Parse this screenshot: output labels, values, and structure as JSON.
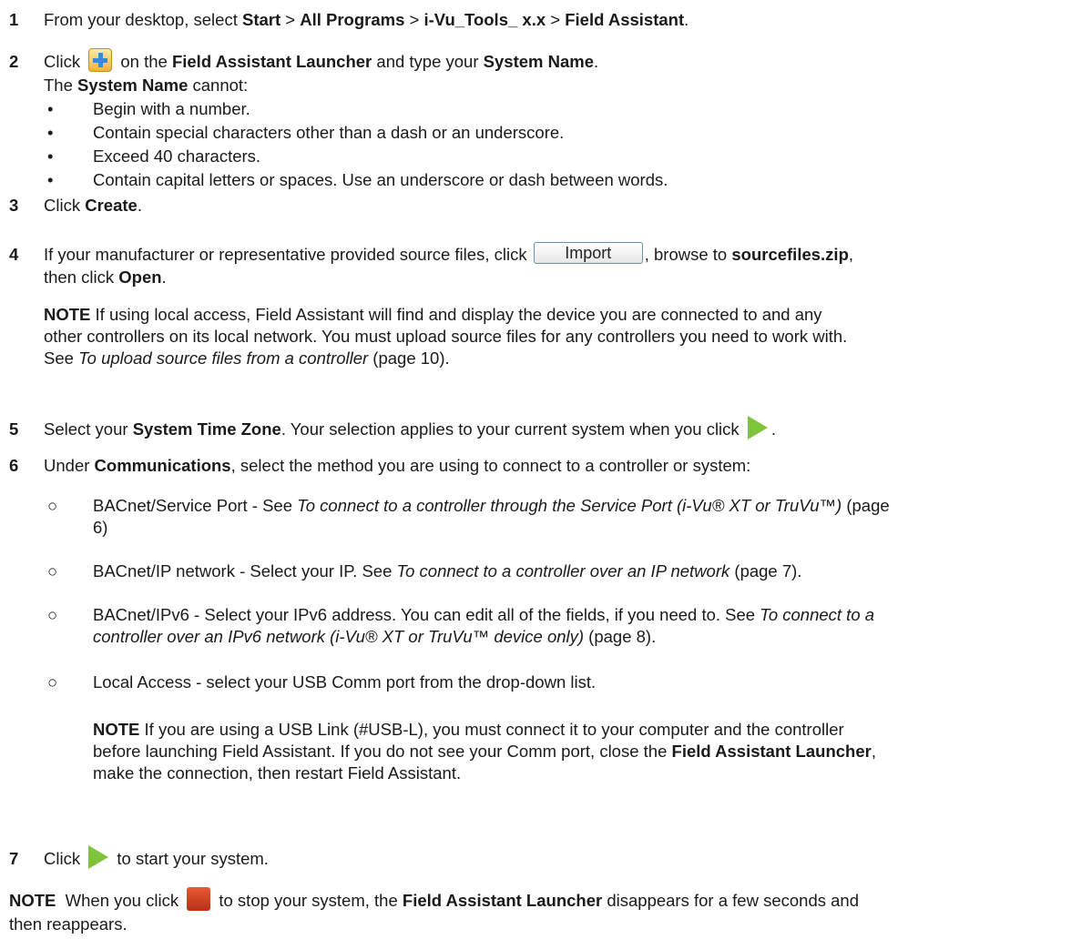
{
  "s1": {
    "num": "1",
    "a": "From your desktop, select ",
    "b1": "Start",
    "sep1": " > ",
    "b2": "All Programs",
    "sep2": " > ",
    "b3": "i-Vu_Tools_ x.x",
    "sep3": " > ",
    "b4": "Field Assistant",
    "end": "."
  },
  "s2": {
    "num": "2",
    "a": "Click ",
    "b": " on the ",
    "b1": "Field Assistant Launcher",
    "c": " and type your ",
    "b2": "System Name",
    "end": ".",
    "l2a": "The ",
    "l2b": "System Name",
    "l2c": " cannot:",
    "bullets": [
      "Begin with a number.",
      "Contain special characters other than a dash or an underscore.",
      "Exceed 40 characters.",
      "Contain capital letters or spaces. Use an underscore or dash between words."
    ]
  },
  "s3": {
    "num": "3",
    "a": "Click ",
    "b": "Create",
    "end": "."
  },
  "s4": {
    "num": "4",
    "a": "If your manufacturer or representative provided source files, click ",
    "btn": "Import",
    "c": ", browse to ",
    "b1": "sourcefiles.zip",
    "d": ",",
    "l2a": "then click ",
    "l2b": "Open",
    "l2c": ".",
    "note_label": "NOTE",
    "note_l1": " If using local access, Field Assistant will find and display the device you are connected to and any",
    "note_l2": "other controllers on its local network. You must upload source files for any controllers you need to work with.",
    "note_l3a": "See ",
    "note_l3i": "To upload source files from a controller",
    "note_l3b": " (page 10)."
  },
  "s5": {
    "num": "5",
    "a": "Select your ",
    "b": "System Time Zone",
    "c": ". Your selection applies to your current system when you click ",
    "end": "."
  },
  "s6": {
    "num": "6",
    "a": "Under ",
    "b": "Communications",
    "c": ", select the method you are using to connect to a controller or system:",
    "o1a": "BACnet/Service Port - See ",
    "o1i": "To connect to a controller through the Service Port (i-Vu® XT or TruVu™)",
    "o1b": " (page",
    "o1c": "6)",
    "o2a": "BACnet/IP network - Select your IP. See ",
    "o2i": "To connect to a controller over an IP network",
    "o2b": " (page 7).",
    "o3a": "BACnet/IPv6 - Select your IPv6 address. You can edit all of the fields, if you need to. See ",
    "o3i": "To connect to a",
    "o3i2": "controller over an IPv6 network (i-Vu® XT or TruVu™ device only)",
    "o3b": " (page 8).",
    "o4": "Local Access - select your USB Comm port from the drop-down list.",
    "note_label": "NOTE",
    "note_l1": " If you are using a USB Link (#USB-L), you must connect it to your computer and the controller",
    "note_l2a": "before launching Field Assistant. If you do not see your Comm port, close the ",
    "note_l2b": "Field Assistant Launcher",
    "note_l2c": ",",
    "note_l3": "make the connection, then restart Field Assistant."
  },
  "s7": {
    "num": "7",
    "a": "Click ",
    "b": " to start your system."
  },
  "final": {
    "label": "NOTE",
    "a": "  When you click ",
    "b": " to stop your system, the ",
    "b1": "Field Assistant Launcher",
    "c": " disappears for a few seconds and",
    "l2": "then reappears."
  },
  "bullet_char": "•",
  "circle_char": "○"
}
